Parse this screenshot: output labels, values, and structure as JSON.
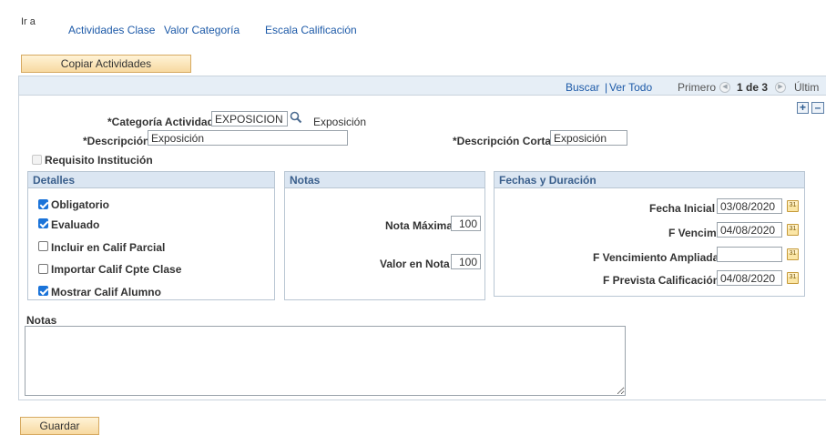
{
  "nav": {
    "ir_a": "Ir a",
    "links": [
      "Actividades Clase",
      "Valor Categoría",
      "Escala Calificación"
    ]
  },
  "copy_button": "Copiar Actividades",
  "grid_bar": {
    "buscar": "Buscar",
    "separator": "|",
    "ver_todo": "Ver Todo",
    "primero": "Primero",
    "count": "1 de 3",
    "ultimo": "Últim"
  },
  "form": {
    "categoria_label": "*Categoría Actividad",
    "categoria_value": "EXPOSICION",
    "categoria_desc": "Exposición",
    "descripcion_label": "*Descripción",
    "descripcion_value": "Exposición",
    "descripcion_corta_label": "*Descripción Corta",
    "descripcion_corta_value": "Exposición",
    "requisito_label": "Requisito Institución",
    "requisito_checked": false
  },
  "detalles": {
    "title": "Detalles",
    "items": [
      {
        "label": "Obligatorio",
        "checked": true
      },
      {
        "label": "Evaluado",
        "checked": true
      },
      {
        "label": "Incluir en Calif Parcial",
        "checked": false
      },
      {
        "label": "Importar Calif Cpte Clase",
        "checked": false
      },
      {
        "label": "Mostrar Calif Alumno",
        "checked": true
      }
    ]
  },
  "notas_group": {
    "title": "Notas",
    "nota_maxima_label": "Nota Máxima",
    "nota_maxima_value": "100",
    "valor_nota_label": "Valor en Nota",
    "valor_nota_value": "100"
  },
  "fechas": {
    "title": "Fechas y Duración",
    "fecha_inicial_label": "Fecha Inicial",
    "fecha_inicial_value": "03/08/2020",
    "f_vencim_label": "F Vencim",
    "f_vencim_value": "04/08/2020",
    "f_venc_ampliada_label": "F Vencimiento Ampliada",
    "f_venc_ampliada_value": "",
    "f_prevista_label": "F Prevista Calificación",
    "f_prevista_value": "04/08/2020",
    "calendar_icon_text": "31"
  },
  "notas_text": {
    "label": "Notas",
    "value": ""
  },
  "save_button": "Guardar",
  "colors": {
    "link": "#1d5aa8",
    "group_header_bg": "#dbe6f2",
    "group_header_text": "#3a5f8c",
    "button_bg": "#f7d9a0",
    "checkbox_on": "#1a73d9"
  }
}
